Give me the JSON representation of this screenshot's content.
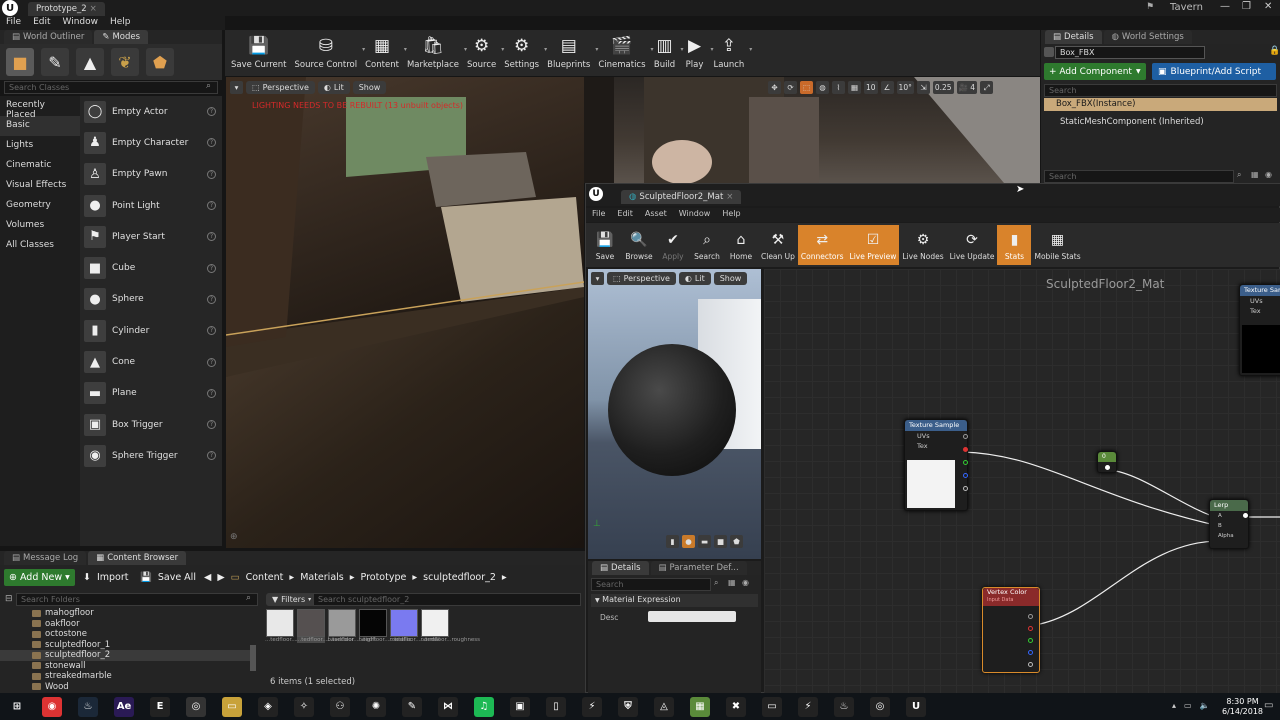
{
  "title_bar": {
    "doc_tab": "Prototype_2",
    "project": "Tavern"
  },
  "menu": [
    "File",
    "Edit",
    "Window",
    "Help"
  ],
  "left_tabs": {
    "outliner": "World Outliner",
    "modes": "Modes"
  },
  "modes": {
    "search_placeholder": "Search Classes",
    "categories": [
      "Recently Placed",
      "Basic",
      "Lights",
      "Cinematic",
      "Visual Effects",
      "Geometry",
      "Volumes",
      "All Classes"
    ],
    "items": [
      {
        "label": "Empty Actor",
        "icon": "◯"
      },
      {
        "label": "Empty Character",
        "icon": "♟"
      },
      {
        "label": "Empty Pawn",
        "icon": "♙"
      },
      {
        "label": "Point Light",
        "icon": "●"
      },
      {
        "label": "Player Start",
        "icon": "⚑"
      },
      {
        "label": "Cube",
        "icon": "■"
      },
      {
        "label": "Sphere",
        "icon": "●"
      },
      {
        "label": "Cylinder",
        "icon": "▮"
      },
      {
        "label": "Cone",
        "icon": "▲"
      },
      {
        "label": "Plane",
        "icon": "▬"
      },
      {
        "label": "Box Trigger",
        "icon": "▣"
      },
      {
        "label": "Sphere Trigger",
        "icon": "◉"
      }
    ]
  },
  "main_toolbar": [
    {
      "label": "Save Current",
      "icon": "💾",
      "name": "save-current"
    },
    {
      "label": "Source Control",
      "icon": "⛁",
      "name": "source-control"
    },
    {
      "label": "Content",
      "icon": "▦",
      "name": "content"
    },
    {
      "label": "Marketplace",
      "icon": "🛍",
      "name": "marketplace"
    },
    {
      "label": "Source",
      "icon": "⚙",
      "name": "source"
    },
    {
      "label": "Settings",
      "icon": "⚙",
      "name": "settings"
    },
    {
      "label": "Blueprints",
      "icon": "▤",
      "name": "blueprints"
    },
    {
      "label": "Cinematics",
      "icon": "🎬",
      "name": "cinematics"
    },
    {
      "label": "Build",
      "icon": "▥",
      "name": "build"
    },
    {
      "label": "Play",
      "icon": "▶",
      "name": "play"
    },
    {
      "label": "Launch",
      "icon": "⇪",
      "name": "launch"
    }
  ],
  "viewport": {
    "perspective": "Perspective",
    "lit": "Lit",
    "show": "Show",
    "warning": "LIGHTING NEEDS TO BE REBUILT (13 unbuilt objects)",
    "grid_snap": "10",
    "angle_snap": "10°",
    "scale_snap": "0.25",
    "cam_speed": "4"
  },
  "details": {
    "tab_details": "Details",
    "tab_world": "World Settings",
    "actor_name": "Box_FBX",
    "add_component": "+ Add Component",
    "blueprint": "Blueprint/Add Script",
    "search_placeholder": "Search",
    "components": [
      "Box_FBX(Instance)",
      "StaticMeshComponent (Inherited)"
    ],
    "search2_placeholder": "Search"
  },
  "material_editor": {
    "tab": "SculptedFloor2_Mat",
    "menu": [
      "File",
      "Edit",
      "Asset",
      "Window",
      "Help"
    ],
    "toolbar": [
      {
        "label": "Save",
        "icon": "💾",
        "state": "normal"
      },
      {
        "label": "Browse",
        "icon": "🔍",
        "state": "normal"
      },
      {
        "label": "Apply",
        "icon": "✔",
        "state": "dim"
      },
      {
        "label": "Search",
        "icon": "⌕",
        "state": "normal"
      },
      {
        "label": "Home",
        "icon": "⌂",
        "state": "normal"
      },
      {
        "label": "Clean Up",
        "icon": "⚒",
        "state": "normal"
      },
      {
        "label": "Connectors",
        "icon": "⇄",
        "state": "on"
      },
      {
        "label": "Live Preview",
        "icon": "☑",
        "state": "on"
      },
      {
        "label": "Live Nodes",
        "icon": "⚙",
        "state": "normal"
      },
      {
        "label": "Live Update",
        "icon": "⟳",
        "state": "normal"
      },
      {
        "label": "Stats",
        "icon": "▮",
        "state": "on"
      },
      {
        "label": "Mobile Stats",
        "icon": "▦",
        "state": "normal"
      }
    ],
    "preview": {
      "perspective": "Perspective",
      "lit": "Lit",
      "show": "Show"
    },
    "graph_title": "SculptedFloor2_Mat",
    "details_tab": "Details",
    "param_tab": "Parameter Def...",
    "search_placeholder": "Search",
    "section": "Material Expression",
    "desc_label": "Desc",
    "nodes": {
      "texture_sample": {
        "title": "Texture Sample",
        "pins": [
          "UVs",
          "Tex"
        ]
      },
      "constant": {
        "value": "0"
      },
      "lerp": {
        "title": "Lerp",
        "pins": [
          "A",
          "B",
          "Alpha"
        ]
      },
      "vertex_color": {
        "title": "Vertex Color",
        "sub": "Input Data"
      },
      "texture_sample_2": {
        "title": "Texture Sam...",
        "pins": [
          "UVs",
          "Tex"
        ]
      }
    }
  },
  "bottom_tabs": {
    "log": "Message Log",
    "browser": "Content Browser"
  },
  "content_browser": {
    "add_new": "Add New",
    "import": "Import",
    "save_all": "Save All",
    "breadcrumb": [
      "Content",
      "Materials",
      "Prototype",
      "sculptedfloor_2"
    ],
    "folder_search": "Search Folders",
    "filters": "Filters",
    "asset_search": "Search sculptedfloor_2",
    "folders": [
      "mahogfloor",
      "oakfloor",
      "octostone",
      "sculptedfloor_1",
      "sculptedfloor_2",
      "stonewall",
      "streakedmarble",
      "Wood"
    ],
    "selected_folder": "sculptedfloor_2",
    "assets": [
      {
        "label": "...tedfloor...AO",
        "color": "#e8e8e8"
      },
      {
        "label": "...tedfloor...basecolor",
        "color": "#555050"
      },
      {
        "label": "...tedfloor...height",
        "color": "#9a9a9a"
      },
      {
        "label": "...tedfloor...metallic",
        "color": "#050505"
      },
      {
        "label": "...tedfloor...normal",
        "color": "#7a7af0"
      },
      {
        "label": "...tedfloor...roughness",
        "color": "#f0f0f0"
      }
    ],
    "status": "6 items (1 selected)"
  },
  "taskbar": {
    "time": "8:30 PM",
    "date": "6/14/2018",
    "apps": [
      {
        "name": "start",
        "glyph": "⊞",
        "color": "#101418"
      },
      {
        "name": "chrome",
        "glyph": "◉",
        "color": "#d33"
      },
      {
        "name": "steam",
        "glyph": "♨",
        "color": "#1b2838"
      },
      {
        "name": "after-effects",
        "glyph": "Ae",
        "color": "#2a1a55"
      },
      {
        "name": "epic",
        "glyph": "E",
        "color": "#222"
      },
      {
        "name": "vr",
        "glyph": "◎",
        "color": "#333"
      },
      {
        "name": "explorer",
        "glyph": "▭",
        "color": "#c8a23a"
      },
      {
        "name": "app-8",
        "glyph": "◈",
        "color": "#222"
      },
      {
        "name": "app-9",
        "glyph": "✧",
        "color": "#222"
      },
      {
        "name": "app-10",
        "glyph": "⚇",
        "color": "#222"
      },
      {
        "name": "app-11",
        "glyph": "✺",
        "color": "#222"
      },
      {
        "name": "app-12",
        "glyph": "✎",
        "color": "#222"
      },
      {
        "name": "app-13",
        "glyph": "⋈",
        "color": "#222"
      },
      {
        "name": "spotify",
        "glyph": "♫",
        "color": "#1db954"
      },
      {
        "name": "app-15",
        "glyph": "▣",
        "color": "#222"
      },
      {
        "name": "app-16",
        "glyph": "▯",
        "color": "#222"
      },
      {
        "name": "app-17",
        "glyph": "⚡",
        "color": "#222"
      },
      {
        "name": "app-18",
        "glyph": "⛨",
        "color": "#222"
      },
      {
        "name": "app-19",
        "glyph": "◬",
        "color": "#222"
      },
      {
        "name": "minecraft",
        "glyph": "▦",
        "color": "#5a8a3a"
      },
      {
        "name": "app-21",
        "glyph": "✖",
        "color": "#222"
      },
      {
        "name": "app-22",
        "glyph": "▭",
        "color": "#222"
      },
      {
        "name": "app-23",
        "glyph": "⚡",
        "color": "#222"
      },
      {
        "name": "steam-2",
        "glyph": "♨",
        "color": "#222"
      },
      {
        "name": "vr-2",
        "glyph": "◎",
        "color": "#222"
      },
      {
        "name": "unreal",
        "glyph": "U",
        "color": "#222"
      }
    ]
  }
}
